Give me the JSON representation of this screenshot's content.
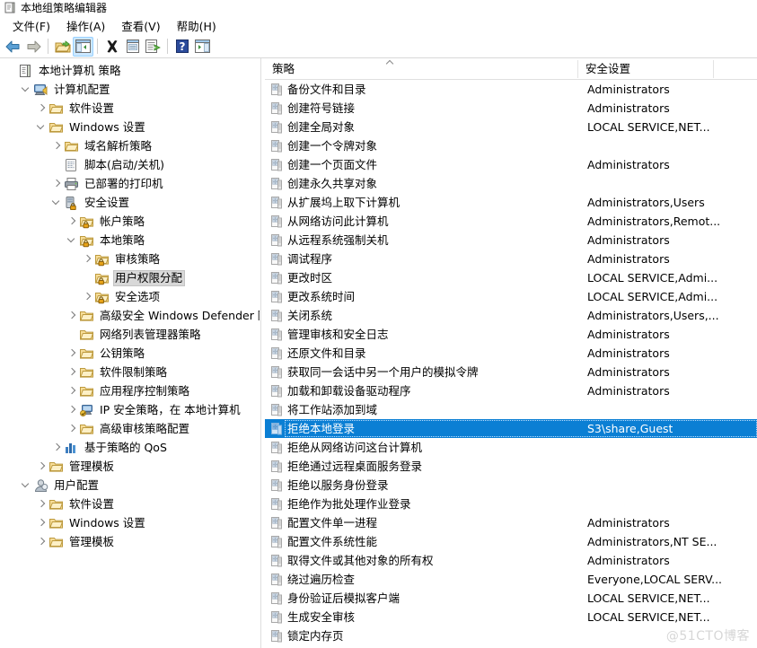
{
  "window": {
    "title": "本地组策略编辑器",
    "title_icon": "console-document-icon"
  },
  "menubar": {
    "items": [
      {
        "label": "文件(F)",
        "name": "menu-file"
      },
      {
        "label": "操作(A)",
        "name": "menu-action"
      },
      {
        "label": "查看(V)",
        "name": "menu-view"
      },
      {
        "label": "帮助(H)",
        "name": "menu-help"
      }
    ]
  },
  "toolbar": {
    "buttons": [
      {
        "icon": "back-arrow-icon",
        "tip": "后退"
      },
      {
        "icon": "forward-arrow-icon",
        "tip": "前进"
      },
      {
        "icon": "up-folder-icon",
        "tip": "上一级"
      },
      {
        "icon": "show-hide-tree-icon",
        "tip": "显示/隐藏控制台树",
        "active": true
      },
      {
        "icon": "delete-x-icon",
        "tip": "删除"
      },
      {
        "icon": "properties-icon",
        "tip": "属性"
      },
      {
        "icon": "export-list-icon",
        "tip": "导出列表"
      },
      {
        "icon": "help-question-icon",
        "tip": "帮助"
      },
      {
        "icon": "show-action-pane-icon",
        "tip": "显示/隐藏操作窗格"
      }
    ]
  },
  "tree": {
    "nodes": [
      {
        "label": "本地计算机 策略",
        "indent": 0,
        "twist": "none",
        "icon": "policy-root-icon",
        "selected": false
      },
      {
        "label": "计算机配置",
        "indent": 1,
        "twist": "open",
        "icon": "computer-icon",
        "selected": false
      },
      {
        "label": "软件设置",
        "indent": 2,
        "twist": "closed",
        "icon": "folder-icon",
        "selected": false
      },
      {
        "label": "Windows 设置",
        "indent": 2,
        "twist": "open",
        "icon": "folder-icon",
        "selected": false
      },
      {
        "label": "域名解析策略",
        "indent": 3,
        "twist": "closed",
        "icon": "folder-icon",
        "selected": false
      },
      {
        "label": "脚本(启动/关机)",
        "indent": 3,
        "twist": "none",
        "icon": "script-icon",
        "selected": false
      },
      {
        "label": "已部署的打印机",
        "indent": 3,
        "twist": "closed",
        "icon": "printer-icon",
        "selected": false
      },
      {
        "label": "安全设置",
        "indent": 3,
        "twist": "open",
        "icon": "security-settings-icon",
        "selected": false
      },
      {
        "label": "帐户策略",
        "indent": 4,
        "twist": "closed",
        "icon": "folder-lock-icon",
        "selected": false
      },
      {
        "label": "本地策略",
        "indent": 4,
        "twist": "open",
        "icon": "folder-lock-icon",
        "selected": false
      },
      {
        "label": "审核策略",
        "indent": 5,
        "twist": "closed",
        "icon": "folder-lock-icon",
        "selected": false
      },
      {
        "label": "用户权限分配",
        "indent": 5,
        "twist": "none",
        "icon": "folder-lock-icon",
        "selected": true
      },
      {
        "label": "安全选项",
        "indent": 5,
        "twist": "closed",
        "icon": "folder-lock-icon",
        "selected": false
      },
      {
        "label": "高级安全 Windows Defender 防火",
        "indent": 4,
        "twist": "closed",
        "icon": "folder-icon",
        "selected": false
      },
      {
        "label": "网络列表管理器策略",
        "indent": 4,
        "twist": "none",
        "icon": "folder-icon",
        "selected": false
      },
      {
        "label": "公钥策略",
        "indent": 4,
        "twist": "closed",
        "icon": "folder-icon",
        "selected": false
      },
      {
        "label": "软件限制策略",
        "indent": 4,
        "twist": "closed",
        "icon": "folder-icon",
        "selected": false
      },
      {
        "label": "应用程序控制策略",
        "indent": 4,
        "twist": "closed",
        "icon": "folder-icon",
        "selected": false
      },
      {
        "label": "IP 安全策略，在 本地计算机",
        "indent": 4,
        "twist": "closed",
        "icon": "ip-security-icon",
        "selected": false
      },
      {
        "label": "高级审核策略配置",
        "indent": 4,
        "twist": "closed",
        "icon": "folder-icon",
        "selected": false
      },
      {
        "label": "基于策略的 QoS",
        "indent": 3,
        "twist": "closed",
        "icon": "qos-chart-icon",
        "selected": false
      },
      {
        "label": "管理模板",
        "indent": 2,
        "twist": "closed",
        "icon": "folder-icon",
        "selected": false
      },
      {
        "label": "用户配置",
        "indent": 1,
        "twist": "open",
        "icon": "user-icon",
        "selected": false
      },
      {
        "label": "软件设置",
        "indent": 2,
        "twist": "closed",
        "icon": "folder-icon",
        "selected": false
      },
      {
        "label": "Windows 设置",
        "indent": 2,
        "twist": "closed",
        "icon": "folder-icon",
        "selected": false
      },
      {
        "label": "管理模板",
        "indent": 2,
        "twist": "closed",
        "icon": "folder-icon",
        "selected": false
      }
    ]
  },
  "list": {
    "columns": [
      {
        "label": "策略",
        "name": "column-policy",
        "sorted": "asc"
      },
      {
        "label": "安全设置",
        "name": "column-security-setting"
      },
      {
        "label": "",
        "name": "column-spare"
      }
    ],
    "rows": [
      {
        "policy": "备份文件和目录",
        "setting": "Administrators",
        "selected": false
      },
      {
        "policy": "创建符号链接",
        "setting": "Administrators",
        "selected": false
      },
      {
        "policy": "创建全局对象",
        "setting": "LOCAL SERVICE,NET...",
        "selected": false
      },
      {
        "policy": "创建一个令牌对象",
        "setting": "",
        "selected": false
      },
      {
        "policy": "创建一个页面文件",
        "setting": "Administrators",
        "selected": false
      },
      {
        "policy": "创建永久共享对象",
        "setting": "",
        "selected": false
      },
      {
        "policy": "从扩展坞上取下计算机",
        "setting": "Administrators,Users",
        "selected": false
      },
      {
        "policy": "从网络访问此计算机",
        "setting": "Administrators,Remot...",
        "selected": false
      },
      {
        "policy": "从远程系统强制关机",
        "setting": "Administrators",
        "selected": false
      },
      {
        "policy": "调试程序",
        "setting": "Administrators",
        "selected": false
      },
      {
        "policy": "更改时区",
        "setting": "LOCAL SERVICE,Admi...",
        "selected": false
      },
      {
        "policy": "更改系统时间",
        "setting": "LOCAL SERVICE,Admi...",
        "selected": false
      },
      {
        "policy": "关闭系统",
        "setting": "Administrators,Users,...",
        "selected": false
      },
      {
        "policy": "管理审核和安全日志",
        "setting": "Administrators",
        "selected": false
      },
      {
        "policy": "还原文件和目录",
        "setting": "Administrators",
        "selected": false
      },
      {
        "policy": "获取同一会话中另一个用户的模拟令牌",
        "setting": "Administrators",
        "selected": false
      },
      {
        "policy": "加载和卸载设备驱动程序",
        "setting": "Administrators",
        "selected": false
      },
      {
        "policy": "将工作站添加到域",
        "setting": "",
        "selected": false
      },
      {
        "policy": "拒绝本地登录",
        "setting": "S3\\share,Guest",
        "selected": true
      },
      {
        "policy": "拒绝从网络访问这台计算机",
        "setting": "",
        "selected": false
      },
      {
        "policy": "拒绝通过远程桌面服务登录",
        "setting": "",
        "selected": false
      },
      {
        "policy": "拒绝以服务身份登录",
        "setting": "",
        "selected": false
      },
      {
        "policy": "拒绝作为批处理作业登录",
        "setting": "",
        "selected": false
      },
      {
        "policy": "配置文件单一进程",
        "setting": "Administrators",
        "selected": false
      },
      {
        "policy": "配置文件系统性能",
        "setting": "Administrators,NT SE...",
        "selected": false
      },
      {
        "policy": "取得文件或其他对象的所有权",
        "setting": "Administrators",
        "selected": false
      },
      {
        "policy": "绕过遍历检查",
        "setting": "Everyone,LOCAL SERV...",
        "selected": false
      },
      {
        "policy": "身份验证后模拟客户端",
        "setting": "LOCAL SERVICE,NET...",
        "selected": false
      },
      {
        "policy": "生成安全审核",
        "setting": "LOCAL SERVICE,NET...",
        "selected": false
      },
      {
        "policy": "锁定内存页",
        "setting": "",
        "selected": false
      }
    ]
  },
  "watermark": {
    "text": "@51CTO博客"
  },
  "colors": {
    "selection_blue": "#0b7fd4",
    "tree_selection_gray": "#d8d8d8",
    "toolbar_active": "#cce8ff",
    "divider": "#e0e0e0"
  }
}
